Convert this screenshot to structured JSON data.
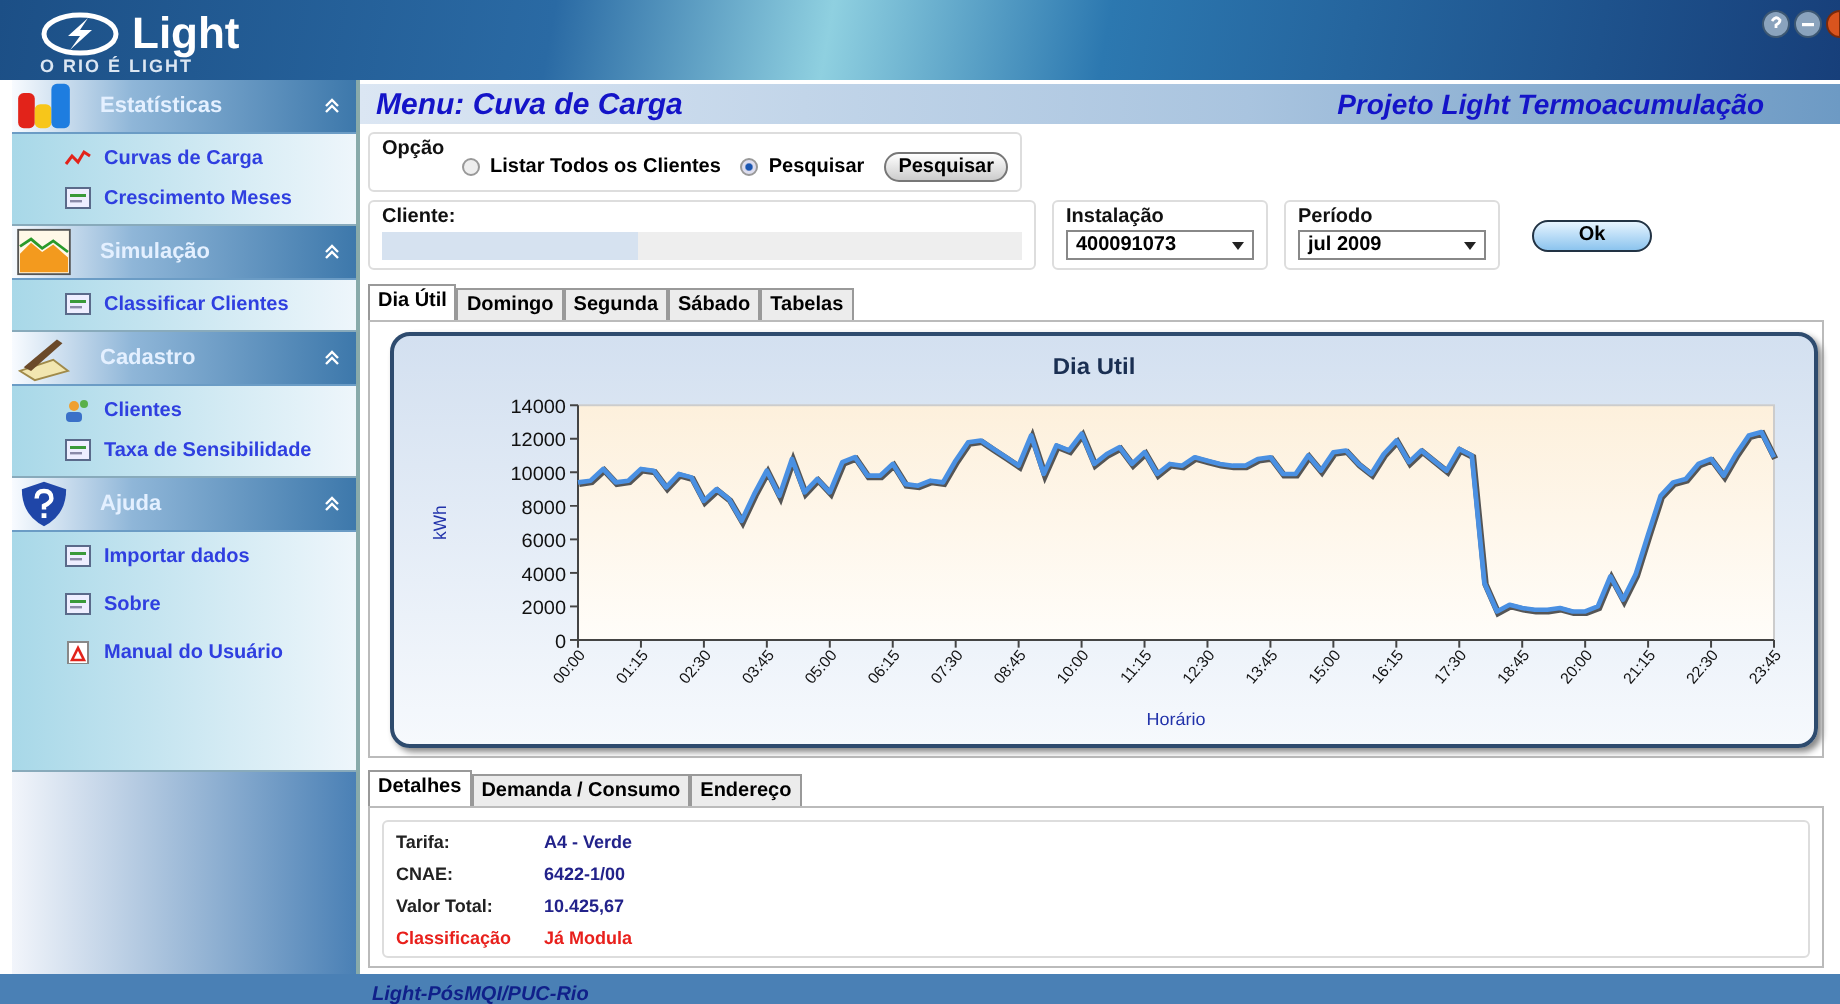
{
  "header": {
    "logo": "Light",
    "slogan": "O RIO É LIGHT"
  },
  "sidebar": {
    "sections": [
      {
        "title": "Estatísticas",
        "expanded": true,
        "items": [
          {
            "label": "Curvas de Carga"
          },
          {
            "label": "Crescimento Meses"
          }
        ]
      },
      {
        "title": "Simulação",
        "expanded": true,
        "items": [
          {
            "label": "Classificar Clientes"
          }
        ]
      },
      {
        "title": "Cadastro",
        "expanded": true,
        "items": [
          {
            "label": "Clientes"
          },
          {
            "label": "Taxa de Sensibilidade"
          }
        ]
      },
      {
        "title": "Ajuda",
        "expanded": true,
        "items": [
          {
            "label": "Importar dados"
          },
          {
            "label": "Sobre"
          },
          {
            "label": "Manual do Usuário"
          }
        ]
      }
    ]
  },
  "title_bar": {
    "menu": "Menu: Cuva de Carga",
    "project": "Projeto Light Termoacumulação"
  },
  "option": {
    "legend": "Opção",
    "radios": [
      {
        "label": "Listar Todos os Clientes",
        "selected": false
      },
      {
        "label": "Pesquisar",
        "selected": true
      }
    ],
    "button": "Pesquisar"
  },
  "client": {
    "legend": "Cliente:"
  },
  "installation": {
    "legend": "Instalação",
    "value": "400091073"
  },
  "period": {
    "legend": "Período",
    "value": "jul 2009"
  },
  "ok_button": "Ok",
  "tabs": [
    {
      "label": "Dia Útil",
      "selected": true
    },
    {
      "label": "Domingo",
      "selected": false
    },
    {
      "label": "Segunda",
      "selected": false
    },
    {
      "label": "Sábado",
      "selected": false
    },
    {
      "label": "Tabelas",
      "selected": false
    }
  ],
  "chart_data": {
    "type": "line",
    "title": "Dia Util",
    "xlabel": "Horário",
    "ylabel": "kWh",
    "ylim": [
      0,
      14000
    ],
    "yticks": [
      0,
      2000,
      4000,
      6000,
      8000,
      10000,
      12000,
      14000
    ],
    "x": [
      0,
      15,
      30,
      45,
      60,
      75,
      90,
      105,
      120,
      135,
      150,
      165,
      180,
      195,
      210,
      225,
      240,
      255,
      270,
      285,
      300,
      315,
      330,
      345,
      360,
      375,
      390,
      405,
      420,
      435,
      450,
      465,
      480,
      495,
      510,
      525,
      540,
      555,
      570,
      585,
      600,
      615,
      630,
      645,
      660,
      675,
      690,
      705,
      720,
      735,
      750,
      765,
      780,
      795,
      810,
      825,
      840,
      855,
      870,
      885,
      900,
      915,
      930,
      945,
      960,
      975,
      990,
      1005,
      1020,
      1035,
      1050,
      1065,
      1080,
      1095,
      1110,
      1125,
      1140,
      1155,
      1170,
      1185,
      1200,
      1215,
      1230,
      1245,
      1260,
      1275,
      1290,
      1305,
      1320,
      1335,
      1350,
      1365,
      1380,
      1395,
      1410,
      1425
    ],
    "xlim": [
      0,
      1425
    ],
    "xticks": [
      {
        "value": 0,
        "label": "00:00"
      },
      {
        "value": 75,
        "label": "01:15"
      },
      {
        "value": 150,
        "label": "02:30"
      },
      {
        "value": 225,
        "label": "03:45"
      },
      {
        "value": 300,
        "label": "05:00"
      },
      {
        "value": 375,
        "label": "06:15"
      },
      {
        "value": 450,
        "label": "07:30"
      },
      {
        "value": 525,
        "label": "08:45"
      },
      {
        "value": 600,
        "label": "10:00"
      },
      {
        "value": 675,
        "label": "11:15"
      },
      {
        "value": 750,
        "label": "12:30"
      },
      {
        "value": 825,
        "label": "13:45"
      },
      {
        "value": 900,
        "label": "15:00"
      },
      {
        "value": 975,
        "label": "16:15"
      },
      {
        "value": 1050,
        "label": "17:30"
      },
      {
        "value": 1125,
        "label": "18:45"
      },
      {
        "value": 1200,
        "label": "20:00"
      },
      {
        "value": 1275,
        "label": "21:15"
      },
      {
        "value": 1350,
        "label": "22:30"
      },
      {
        "value": 1425,
        "label": "23:45"
      }
    ],
    "series": [
      {
        "color": "#4a90e2",
        "values": [
          9400,
          9500,
          10200,
          9400,
          9500,
          10200,
          10100,
          9100,
          9900,
          9700,
          8300,
          9000,
          8400,
          7100,
          8700,
          10100,
          8600,
          10800,
          8800,
          9600,
          8800,
          10600,
          10900,
          9800,
          9800,
          10500,
          9300,
          9200,
          9500,
          9400,
          10700,
          11800,
          11900,
          11400,
          10900,
          10400,
          12200,
          9900,
          11600,
          11300,
          12300,
          10500,
          11100,
          11500,
          10500,
          11200,
          9900,
          10500,
          10400,
          10900,
          10700,
          10500,
          10400,
          10400,
          10800,
          10900,
          9900,
          9900,
          11000,
          10100,
          11200,
          11300,
          10500,
          9900,
          11100,
          11900,
          10600,
          11300,
          10700,
          10100,
          11400,
          11000,
          3400,
          1700,
          2100,
          1900,
          1800,
          1800,
          1900,
          1700,
          1700,
          2000,
          3800,
          2400,
          3900,
          6300,
          8600,
          9400,
          9600,
          10500,
          10800,
          9800,
          11100,
          12200,
          12400,
          10900
        ]
      }
    ]
  },
  "detail_tabs": [
    {
      "label": "Detalhes",
      "selected": true
    },
    {
      "label": "Demanda / Consumo",
      "selected": false
    },
    {
      "label": "Endereço",
      "selected": false
    }
  ],
  "details": [
    {
      "label": "Tarifa:",
      "value": "A4 - Verde",
      "kind": "normal"
    },
    {
      "label": "CNAE:",
      "value": "6422-1/00",
      "kind": "normal"
    },
    {
      "label": "Valor Total:",
      "value": "10.425,67",
      "kind": "normal"
    },
    {
      "label": "Classificação",
      "value": "Já Modula",
      "kind": "alert"
    }
  ],
  "footer": "Light-PósMQI/PUC-Rio"
}
